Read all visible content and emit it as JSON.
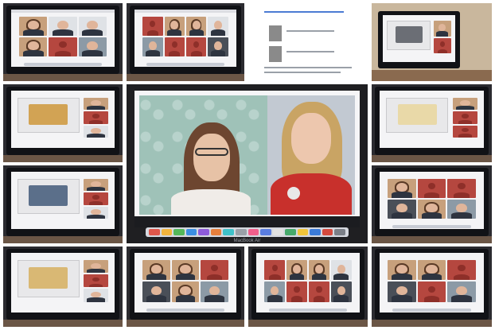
{
  "center": {
    "left_label": "",
    "right_label": "",
    "brand": "MacBook Air"
  },
  "dock_colors": [
    "#e0574b",
    "#f3b43d",
    "#54b85a",
    "#3b8fe2",
    "#8e5bd9",
    "#e67f3c",
    "#3fc1c9",
    "#9aa0a8",
    "#f25f8c",
    "#5a7de0",
    "#e1e1e1",
    "#46a96b",
    "#f0c43a",
    "#3b7bd8",
    "#d54a3e",
    "#7b7f87"
  ]
}
